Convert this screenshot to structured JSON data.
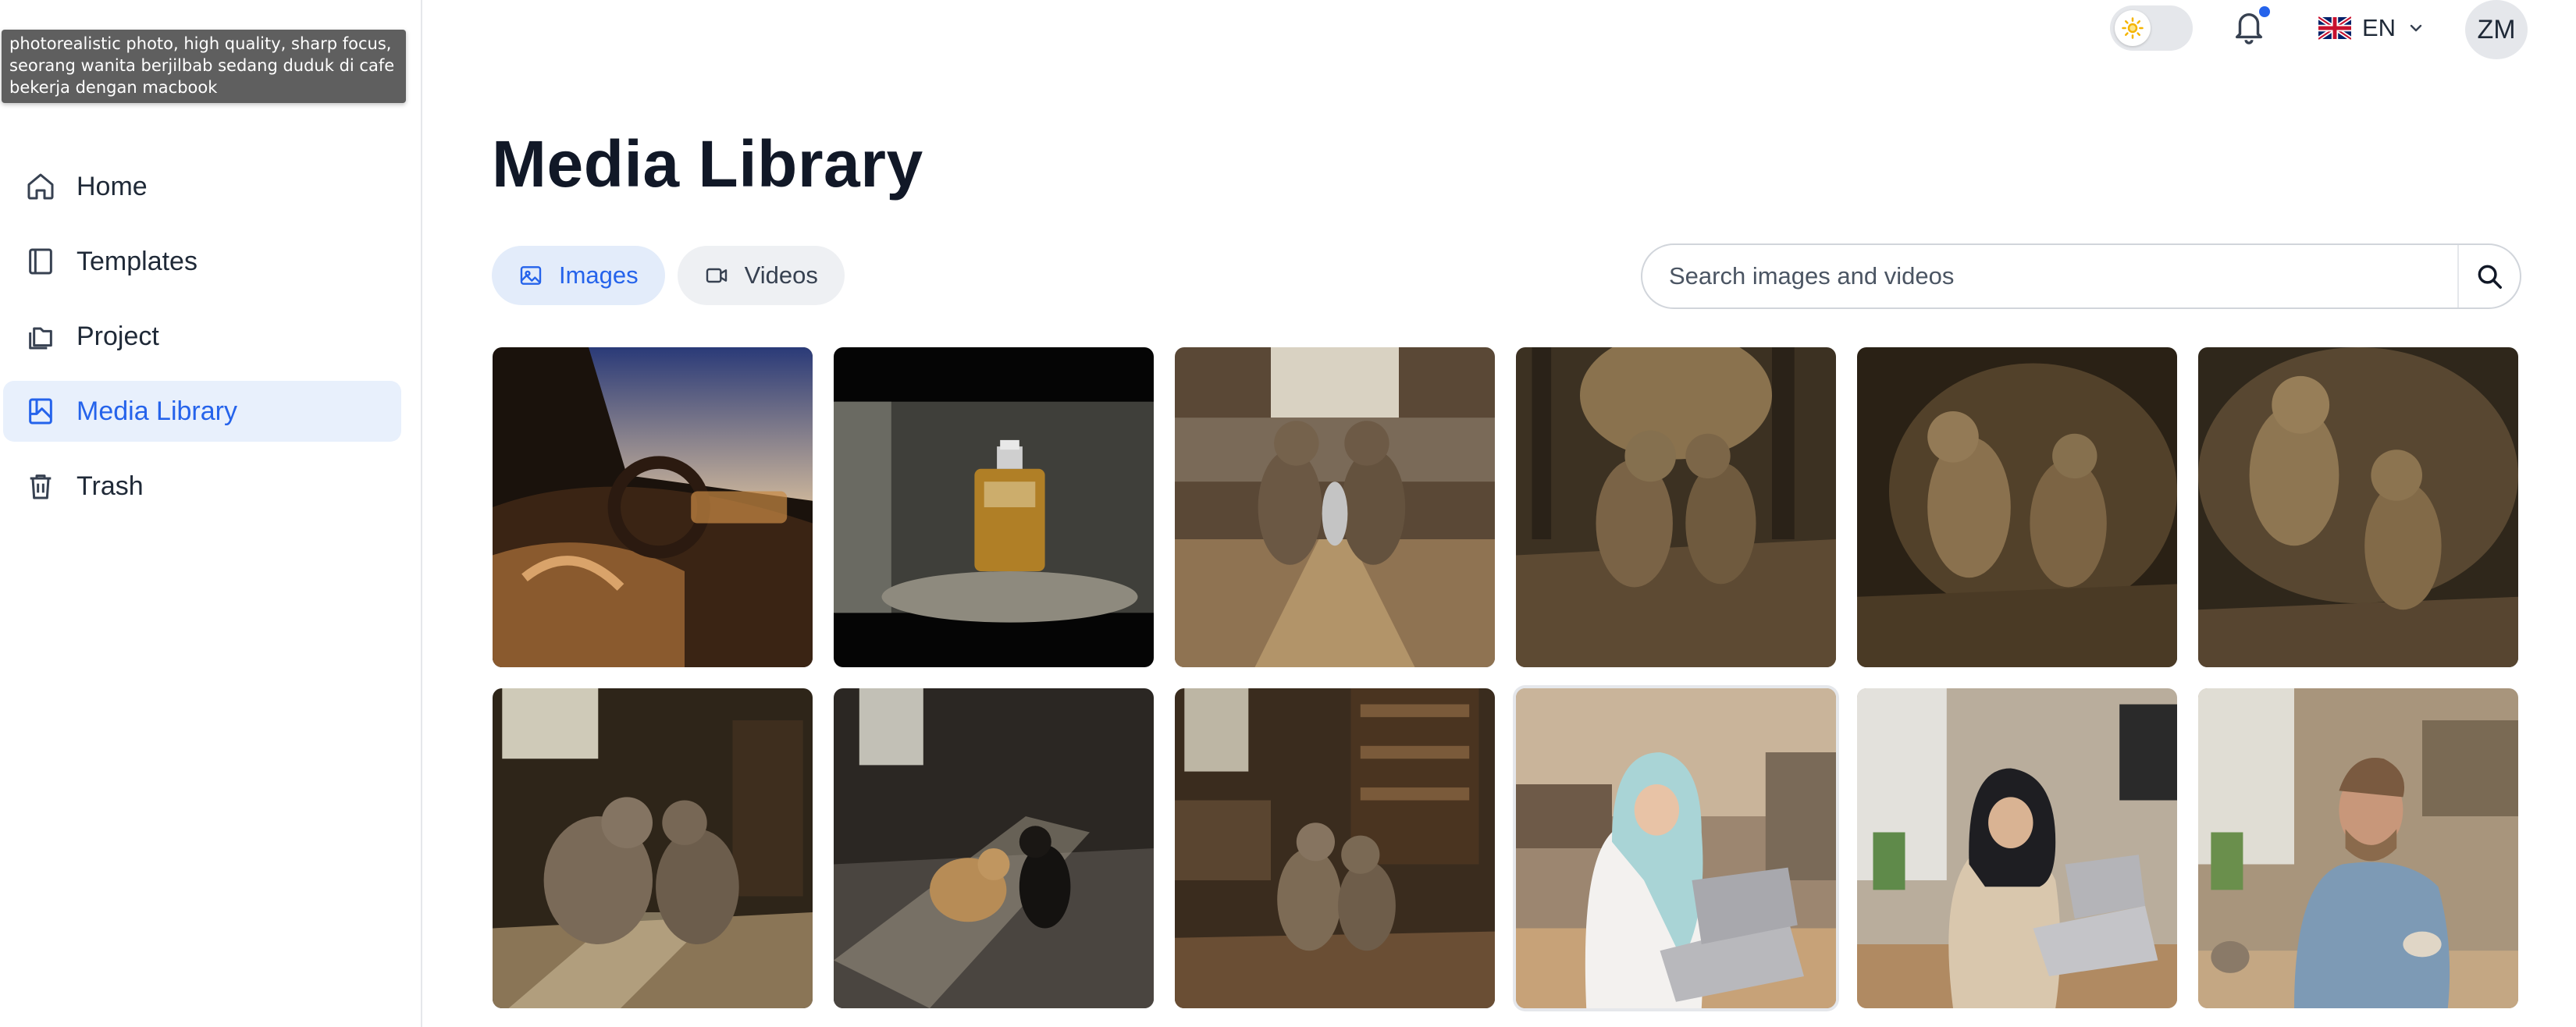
{
  "tooltip": {
    "text": "photorealistic photo, high quality, sharp focus, seorang wanita berjilbab sedang duduk di cafe bekerja dengan macbook"
  },
  "sidebar": {
    "items": [
      {
        "label": "Home",
        "icon": "home-icon",
        "active": false
      },
      {
        "label": "Templates",
        "icon": "book-icon",
        "active": false
      },
      {
        "label": "Project",
        "icon": "folders-icon",
        "active": false
      },
      {
        "label": "Media Library",
        "icon": "media-library-icon",
        "active": true
      },
      {
        "label": "Trash",
        "icon": "trash-icon",
        "active": false
      }
    ]
  },
  "header": {
    "language": "EN",
    "avatar_initials": "ZM",
    "has_notification": true
  },
  "main": {
    "title": "Media Library",
    "tabs": [
      {
        "label": "Images",
        "icon": "image-icon",
        "active": true
      },
      {
        "label": "Videos",
        "icon": "video-icon",
        "active": false
      }
    ],
    "search": {
      "placeholder": "Search images and videos",
      "value": ""
    }
  },
  "media": [
    {
      "kind": "car-interior"
    },
    {
      "kind": "perfume-bottle"
    },
    {
      "kind": "cats-kitchen"
    },
    {
      "kind": "cats-forest"
    },
    {
      "kind": "cats-dark"
    },
    {
      "kind": "cats-dark-2"
    },
    {
      "kind": "cats-window"
    },
    {
      "kind": "cats-brick"
    },
    {
      "kind": "cats-library"
    },
    {
      "kind": "woman-hijab-cafe-1",
      "selected": true
    },
    {
      "kind": "woman-hijab-cafe-2"
    },
    {
      "kind": "man-cafe"
    }
  ],
  "colors": {
    "accent": "#2563eb",
    "active_bg": "#e8f0fc"
  }
}
